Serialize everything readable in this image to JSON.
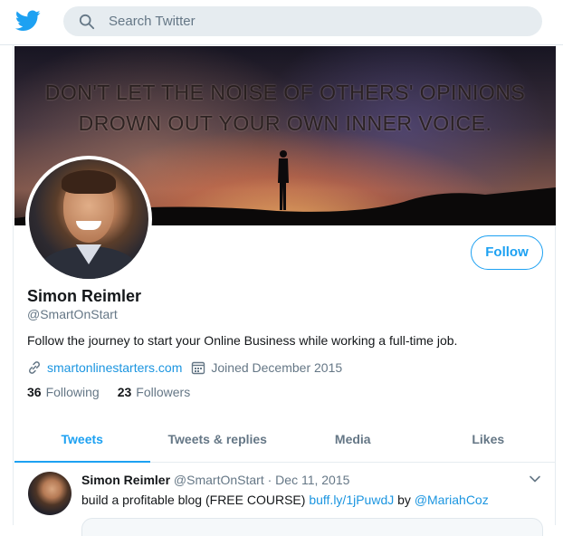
{
  "topbar": {
    "logo_icon": "twitter-bird-icon",
    "search_placeholder": "Search Twitter",
    "search_icon": "search-icon"
  },
  "banner": {
    "quote_line1": "DON'T LET THE NOISE OF OTHERS' OPINIONS",
    "quote_line2": "DROWN OUT YOUR OWN INNER VOICE."
  },
  "profile": {
    "name": "Simon Reimler",
    "handle": "@SmartOnStart",
    "bio": "Follow the journey to start your Online Business while working a full-time job.",
    "website": "smartonlinestarters.com",
    "joined": "Joined December 2015",
    "following_count": "36",
    "following_label": "Following",
    "followers_count": "23",
    "followers_label": "Followers",
    "follow_button": "Follow"
  },
  "tabs": [
    {
      "label": "Tweets",
      "active": true
    },
    {
      "label": "Tweets & replies",
      "active": false
    },
    {
      "label": "Media",
      "active": false
    },
    {
      "label": "Likes",
      "active": false
    }
  ],
  "tweet": {
    "author_name": "Simon Reimler",
    "author_handle": "@SmartOnStart",
    "separator": "·",
    "date": "Dec 11, 2015",
    "text_prefix": "build a profitable blog (FREE COURSE) ",
    "link": "buff.ly/1jPuwdJ",
    "text_by": " by ",
    "mention": "@MariahCoz"
  },
  "colors": {
    "accent": "#1da1f2",
    "link": "#1b95e0",
    "muted": "#657786"
  }
}
